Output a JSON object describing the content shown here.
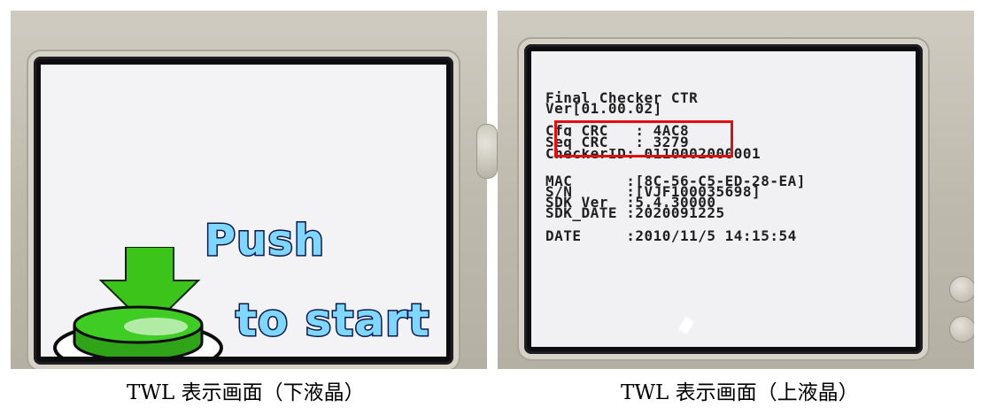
{
  "left_photo": {
    "screen": {
      "line1": "Push",
      "line2": "to start"
    },
    "caption": "TWL 表示画面（下液晶）"
  },
  "right_photo": {
    "screen": {
      "header_line1": "Final Checker CTR",
      "header_line2": "Ver[01.00.02]",
      "cfg_crc": "Cfg CRC   : 4AC8",
      "seq_crc": "Seq CRC   : 3279",
      "checker_id": "CheckerID: 0110002000001",
      "mac": "MAC      :[8C-56-C5-ED-28-EA]",
      "sn": "S/N      :[VJF100035698]",
      "sdk_ver": "SDK Ver  :5.4.30000",
      "sdk_date": "SDK_DATE :2020091225",
      "date": "DATE     :2010/11/5 14:15:54"
    },
    "caption": "TWL 表示画面（上液晶）"
  },
  "colors": {
    "highlight": "#e01010",
    "push_text": "#7fd6ff",
    "arrow_green": "#3cc41a"
  }
}
